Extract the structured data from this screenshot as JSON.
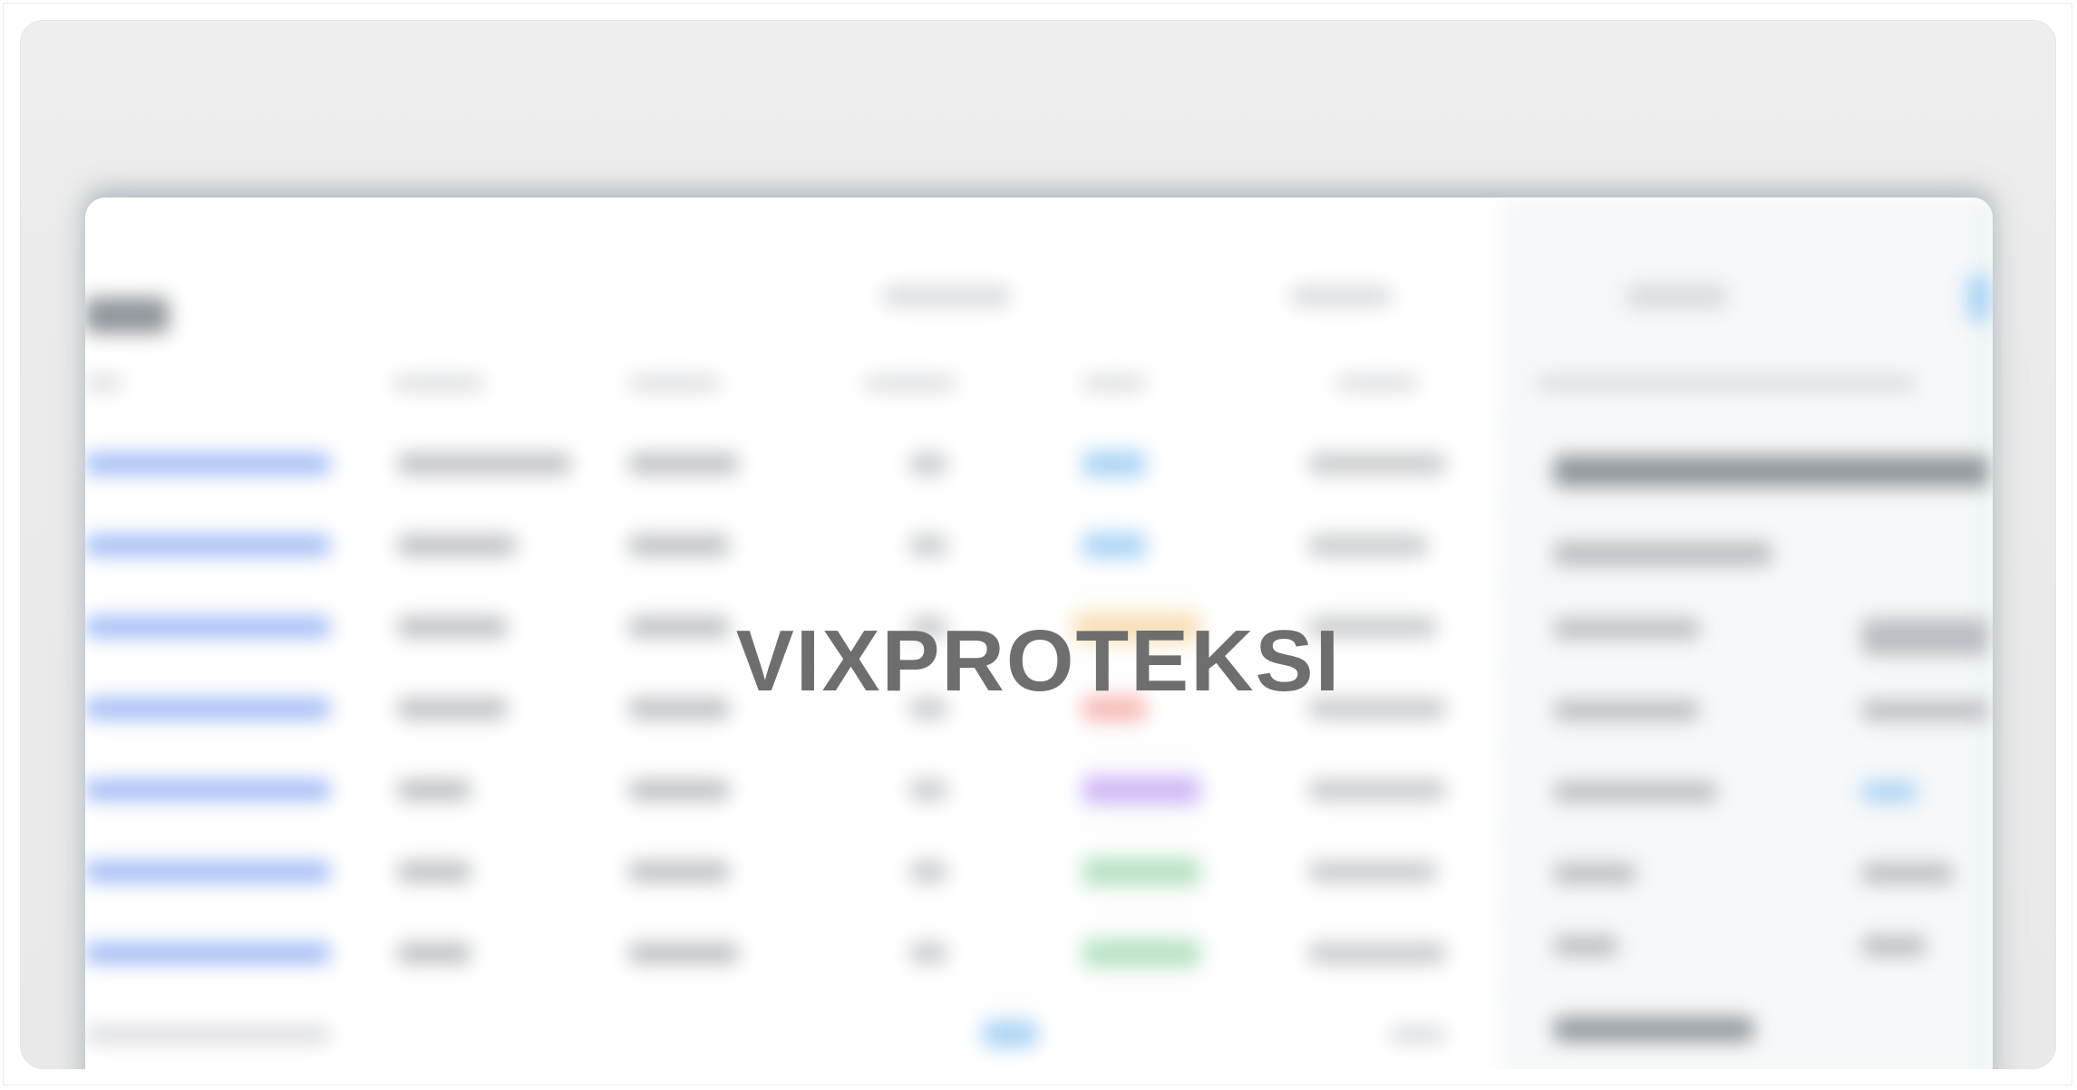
{
  "watermark": {
    "text": "VIXPROTEKSI"
  },
  "colors": {
    "background": "#eeeeee",
    "card": "#ffffff",
    "link": "#9bb7f4",
    "status_blue": "#a9d3f5",
    "status_orange": "#f7dfb5",
    "status_red": "#f6b9b5",
    "status_purple": "#cfb8f7",
    "status_green": "#b7e2c4",
    "watermark": "#6e6e6e"
  }
}
